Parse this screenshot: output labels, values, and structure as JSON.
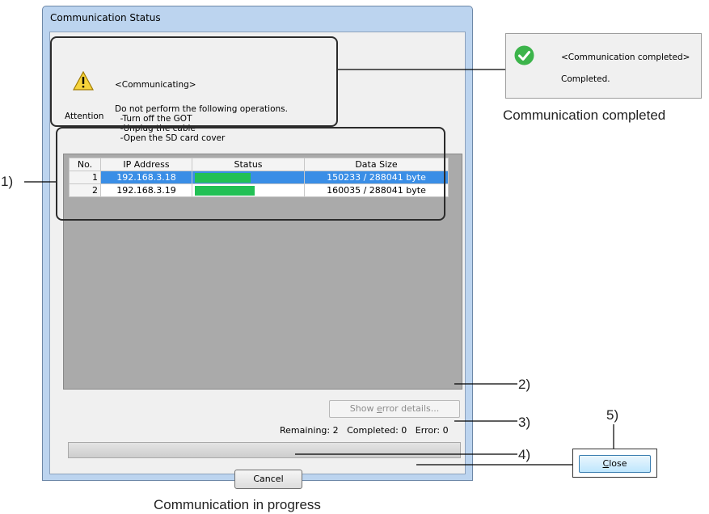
{
  "dialog": {
    "title": "Communication Status",
    "attention_label": "Attention",
    "communicating": "<Communicating>",
    "notice": "Do not perform the following operations.\n  -Turn off the GOT\n  -Unplug the cable\n  -Open the SD card cover"
  },
  "table": {
    "columns": [
      "No.",
      "IP Address",
      "Status",
      "Data Size"
    ],
    "rows": [
      {
        "no": "1",
        "ip": "192.168.3.18",
        "progress": 0.52,
        "size": "150233 / 288041 byte",
        "selected": true
      },
      {
        "no": "2",
        "ip": "192.168.3.19",
        "progress": 0.56,
        "size": "160035 / 288041 byte",
        "selected": false
      }
    ]
  },
  "error_button": {
    "pre": "Show ",
    "key": "e",
    "post": "rror details..."
  },
  "counts": "Remaining: 2   Completed: 0   Error: 0",
  "cancel_label": "Cancel",
  "popup": {
    "message": "<Communication completed>",
    "detail": "Completed.",
    "icon": "check-circle-icon",
    "icon_color": "#3cb44b"
  },
  "captions": {
    "completed": "Communication completed",
    "progress": "Communication in progress"
  },
  "close_button": {
    "key": "C",
    "rest": "lose"
  },
  "callouts": {
    "list": "1)",
    "error": "2)",
    "progress": "3)",
    "cancel": "4)",
    "close": "5)"
  },
  "colors": {
    "selected_row": "#3a8ee6",
    "progress_bar": "#22c055",
    "list_background": "#aaaaaa"
  }
}
